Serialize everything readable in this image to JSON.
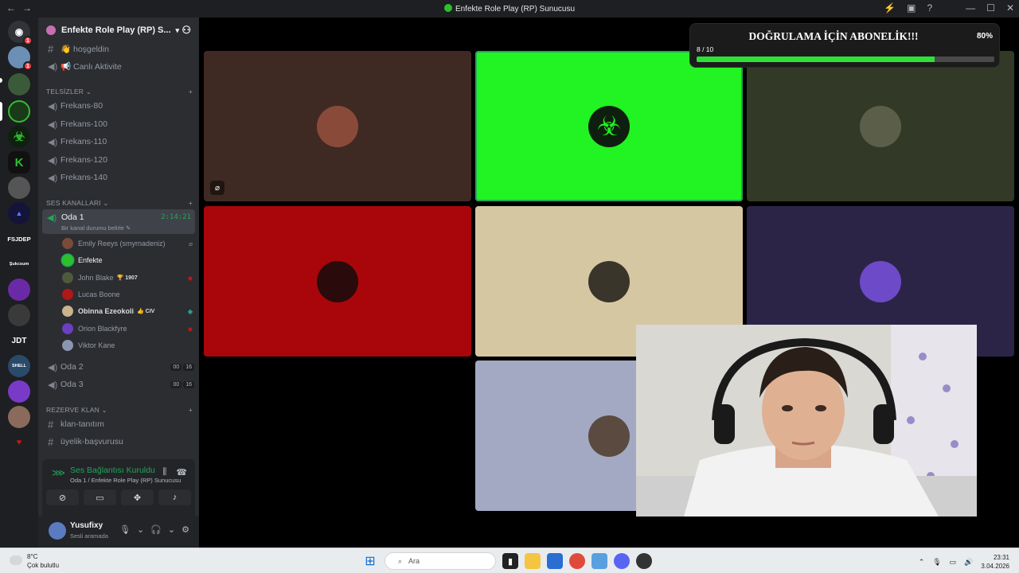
{
  "window": {
    "title": "Enfekte Role Play (RP) Sunucusu",
    "nav_back": "←",
    "nav_forward": "→",
    "controls": [
      "—",
      "☐",
      "✕"
    ]
  },
  "rail": {
    "home_badge": "1",
    "server_badges": [
      "1",
      "1"
    ],
    "labels": [
      "FSJDEP",
      "JDT",
      "K"
    ],
    "small_texts": [
      "Şukcsum",
      "SHELL"
    ]
  },
  "sidebar": {
    "server_name": "Enfekte Role Play (RP) S...",
    "channels_top": [
      {
        "type": "text",
        "label": "👋 hoşgeldin"
      },
      {
        "type": "voice",
        "label": "📢 Canlı Aktivite"
      }
    ],
    "category_telsizler": "TELSİZLER",
    "telsizler": [
      "Frekans-80",
      "Frekans-100",
      "Frekans-110",
      "Frekans-120",
      "Frekans-140"
    ],
    "category_ses": "SES KANALLARI",
    "active_channel": {
      "name": "Oda 1",
      "time": "2:14:21",
      "status": "Bir kanal durumu belirle"
    },
    "members": [
      {
        "name": "Emily Reeys (smyrnadeniz)",
        "tag": "",
        "color": "#7a4a3a"
      },
      {
        "name": "Enfekte",
        "tag": "",
        "color": "#2dc02d"
      },
      {
        "name": "John Blake",
        "tag": "🏆 1907",
        "color": "#4d5a3c"
      },
      {
        "name": "Lucas Boone",
        "tag": "",
        "color": "#b01818"
      },
      {
        "name": "Obinna Ezeokoli",
        "tag": "👍 CIV",
        "color": "#c9b48f"
      },
      {
        "name": "Orion Blackfyre",
        "tag": "",
        "color": "#6a3fc0"
      },
      {
        "name": "Viktor Kane",
        "tag": "",
        "color": "#8c95b0"
      }
    ],
    "other_rooms": [
      {
        "name": "Oda 2",
        "a": "00",
        "b": "16"
      },
      {
        "name": "Oda 3",
        "a": "00",
        "b": "16"
      }
    ],
    "category_rezerve": "REZERVE KLAN",
    "rezerve": [
      "klan-tanıtım",
      "üyelik-başvurusu"
    ]
  },
  "voice_panel": {
    "title": "Ses Bağlantısı Kuruldu",
    "subtitle": "Oda 1 / Enfekte Role Play (RP) Sunucusu"
  },
  "user": {
    "name": "Yusufixy",
    "status": "Sesli aramada"
  },
  "overlay": {
    "title": "DOĞRULAMA İÇİN ABONELİK!!!",
    "count": "8 / 10",
    "percent_label": "80%",
    "progress": 0.8
  },
  "tiles": [
    {
      "bg": "#3f2a23",
      "avatar": "#8a4a3a",
      "name": "Emily Reeys"
    },
    {
      "bg": "#22f322",
      "avatar": "#0f1f0f",
      "name": "Enfekte"
    },
    {
      "bg": "#323a27",
      "avatar": "#5b5f4a",
      "name": "John Blake"
    },
    {
      "bg": "#a8060b",
      "avatar": "#2a0a0a",
      "name": "Lucas Boone"
    },
    {
      "bg": "#d6c7a3",
      "avatar": "#3a352b",
      "name": "Obinna Ezeokoli"
    },
    {
      "bg": "#2c2447",
      "avatar": "#6d4ac8",
      "name": "Orion Blackfyre"
    },
    {
      "bg": "#a3a9c2",
      "avatar": "#5a4a40",
      "name": "Viktor Kane"
    }
  ],
  "taskbar": {
    "temp": "8°C",
    "weather": "Çok bulutlu",
    "search_placeholder": "Ara",
    "time": "23:31",
    "date": "3.04.2026"
  }
}
